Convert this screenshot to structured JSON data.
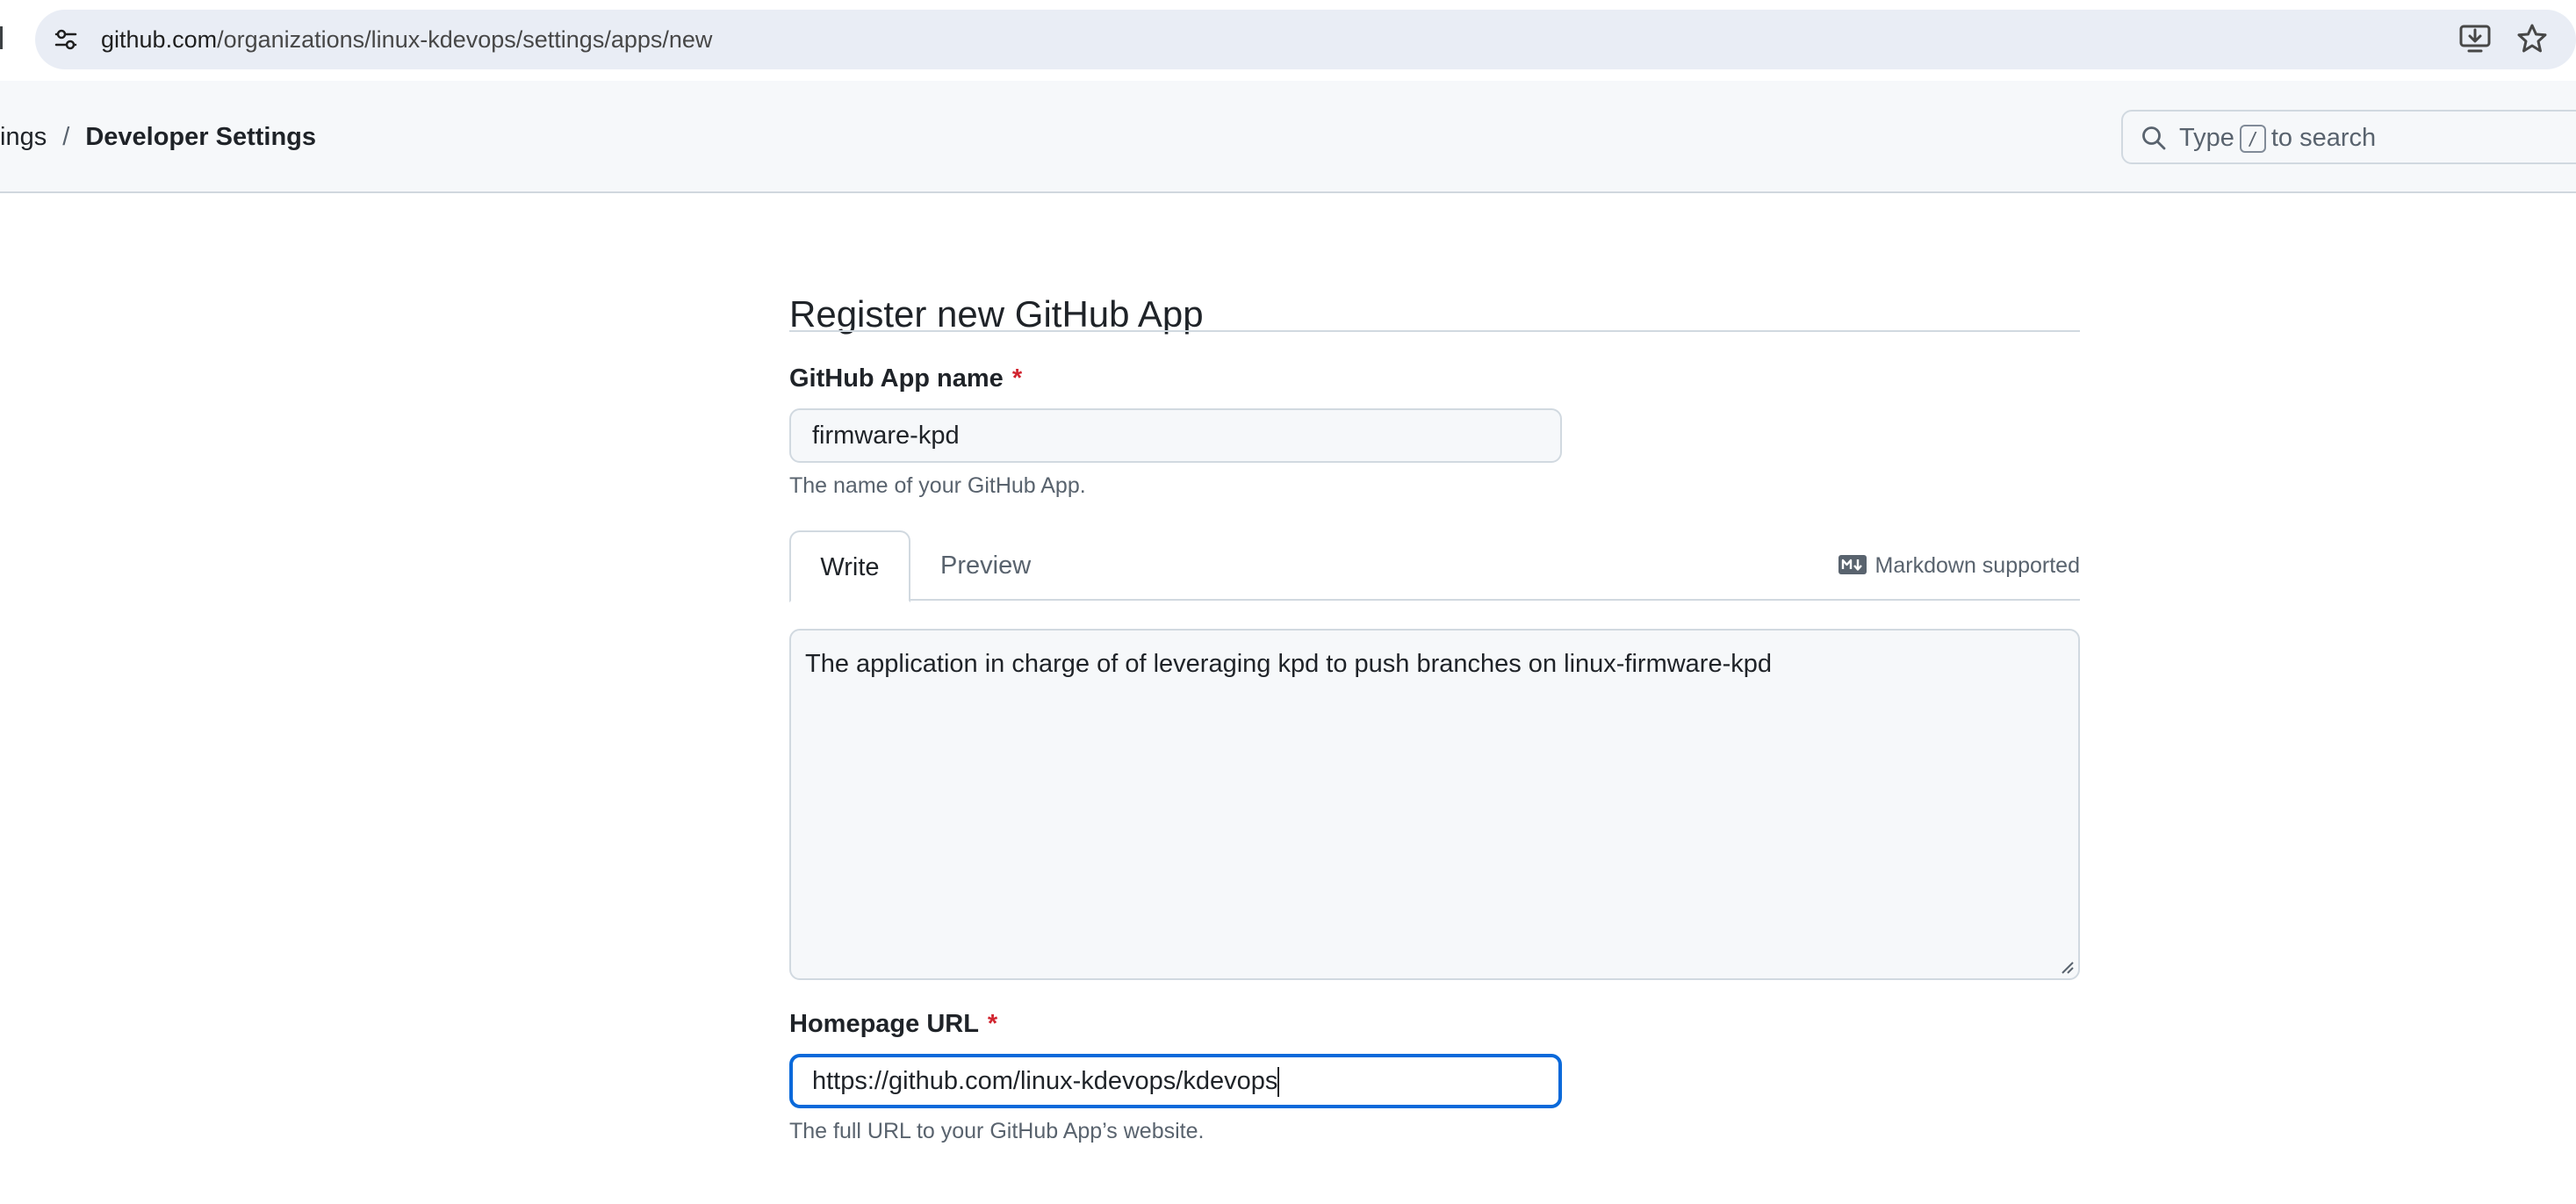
{
  "browser": {
    "url_host": "github.com",
    "url_path": "/organizations/linux-kdevops/settings/apps/new",
    "site_info_icon": "tune-icon",
    "install_icon": "install-app-icon",
    "bookmark_icon": "star-icon"
  },
  "header": {
    "breadcrumb_prev": "tings",
    "breadcrumb_separator": "/",
    "breadcrumb_current": "Developer Settings",
    "search": {
      "prefix": "Type",
      "key": "/",
      "suffix": "to search",
      "icon": "search-icon"
    }
  },
  "form": {
    "title": "Register new GitHub App",
    "app_name": {
      "label": "GitHub App name",
      "required_mark": "*",
      "value": "firmware-kpd",
      "hint": "The name of your GitHub App."
    },
    "description": {
      "tabs": [
        "Write",
        "Preview"
      ],
      "active_tab": "Write",
      "markdown_hint": "Markdown supported",
      "value": "The application in charge of of leveraging kpd to push branches on linux-firmware-kpd"
    },
    "homepage_url": {
      "label": "Homepage URL",
      "required_mark": "*",
      "value": "https://github.com/linux-kdevops/kdevops",
      "hint": "The full URL to your GitHub App’s website."
    }
  },
  "colors": {
    "accent": "#0969da",
    "required": "#d1242f",
    "muted_text": "#59636e",
    "border": "#d1d9e0",
    "header_bg": "#f6f8fa"
  }
}
